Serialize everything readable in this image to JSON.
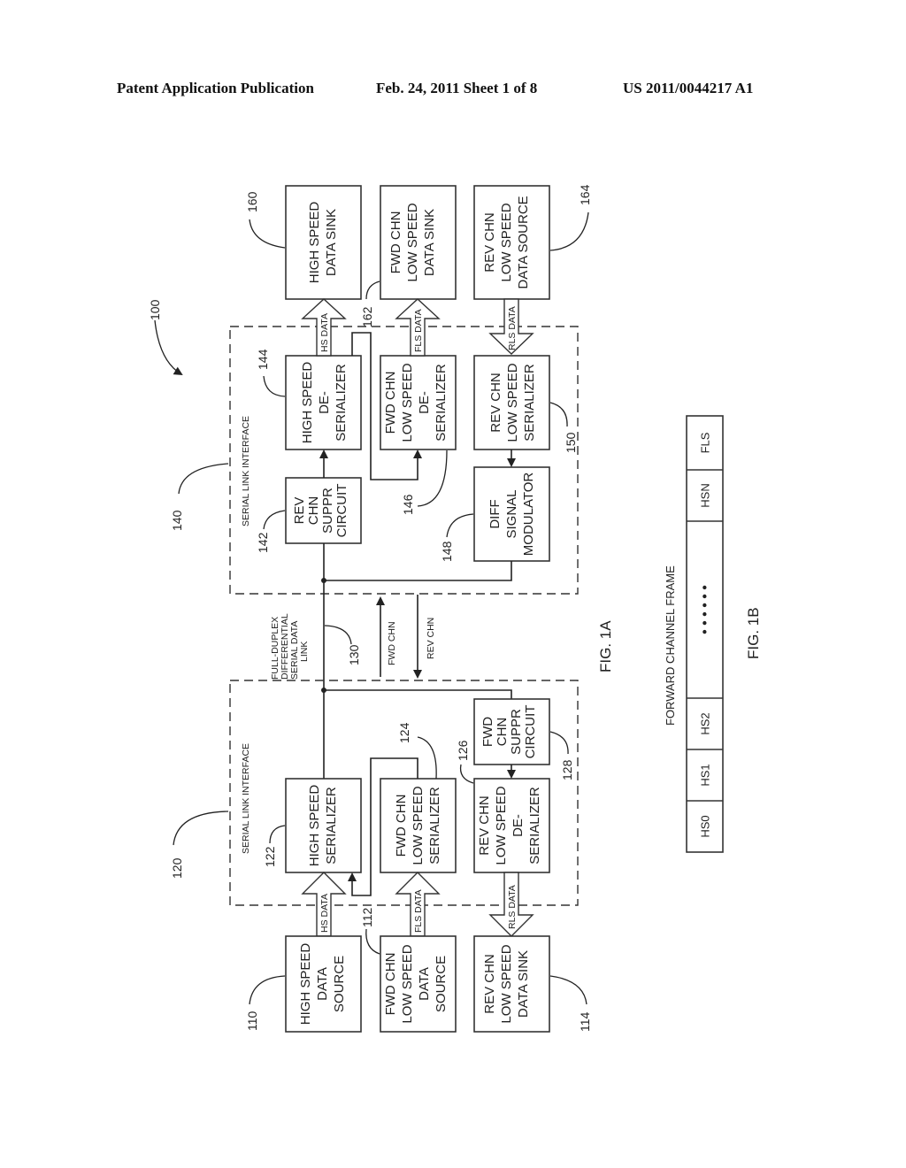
{
  "header": {
    "publication": "Patent Application Publication",
    "date_sheet": "Feb. 24, 2011   Sheet 1 of 8",
    "number": "US 2011/0044217 A1"
  },
  "fig1a": {
    "caption": "FIG. 1A",
    "system_ref": "100",
    "top_blocks": [
      {
        "ref": "160",
        "lines": [
          "HIGH SPEED",
          "DATA SINK"
        ]
      },
      {
        "ref": "162",
        "lines": [
          "FWD CHN",
          "LOW SPEED",
          "DATA SINK"
        ]
      },
      {
        "ref": "164",
        "lines": [
          "REV CHN",
          "LOW SPEED",
          "DATA SOURCE"
        ]
      }
    ],
    "top_interface": {
      "ref": "140",
      "label": "SERIAL LINK INTERFACE",
      "blocks": [
        {
          "ref": "144",
          "lines": [
            "HIGH SPEED",
            "DE-",
            "SERIALIZER"
          ]
        },
        {
          "ref": "146",
          "lines": [
            "FWD CHN",
            "LOW SPEED",
            "DE-",
            "SERIALIZER"
          ]
        },
        {
          "ref": "150",
          "lines": [
            "REV CHN",
            "LOW SPEED",
            "SERIALIZER"
          ]
        },
        {
          "ref": "142",
          "lines": [
            "REV",
            "CHN",
            "SUPPR",
            "CIRCUIT"
          ]
        },
        {
          "ref": "148",
          "lines": [
            "DIFF",
            "SIGNAL",
            "MODULATOR"
          ]
        }
      ]
    },
    "link": {
      "ref": "130",
      "lines": [
        "FULL-DUPLEX",
        "DIFFERENTIAL",
        "SERIAL DATA",
        "LINK"
      ],
      "fwd": "FWD CHN",
      "rev": "REV CHN"
    },
    "bottom_interface": {
      "ref": "120",
      "label": "SERIAL LINK INTERFACE",
      "blocks": [
        {
          "ref": "122",
          "lines": [
            "HIGH SPEED",
            "SERIALIZER"
          ]
        },
        {
          "ref": "124",
          "lines": [
            "FWD CHN",
            "LOW SPEED",
            "SERIALIZER"
          ]
        },
        {
          "ref": "126",
          "lines": [
            "REV CHN",
            "LOW SPEED",
            "DE-",
            "SERIALIZER"
          ]
        },
        {
          "ref": "128",
          "lines": [
            "FWD",
            "CHN",
            "SUPPR",
            "CIRCUIT"
          ]
        }
      ]
    },
    "bottom_blocks": [
      {
        "ref": "110",
        "lines": [
          "HIGH SPEED",
          "DATA",
          "SOURCE"
        ]
      },
      {
        "ref": "112",
        "lines": [
          "FWD CHN",
          "LOW SPEED",
          "DATA",
          "SOURCE"
        ]
      },
      {
        "ref": "114",
        "lines": [
          "REV CHN",
          "LOW SPEED",
          "DATA SINK"
        ]
      }
    ],
    "bus_labels": {
      "hs": "HS DATA",
      "fls": "FLS DATA",
      "rls": "RLS DATA"
    }
  },
  "fig1b": {
    "caption": "FIG. 1B",
    "title": "FORWARD CHANNEL FRAME",
    "slots": [
      "HS0",
      "HS1",
      "HS2",
      "•  •  •  •  •  •",
      "HSN",
      "FLS"
    ]
  }
}
